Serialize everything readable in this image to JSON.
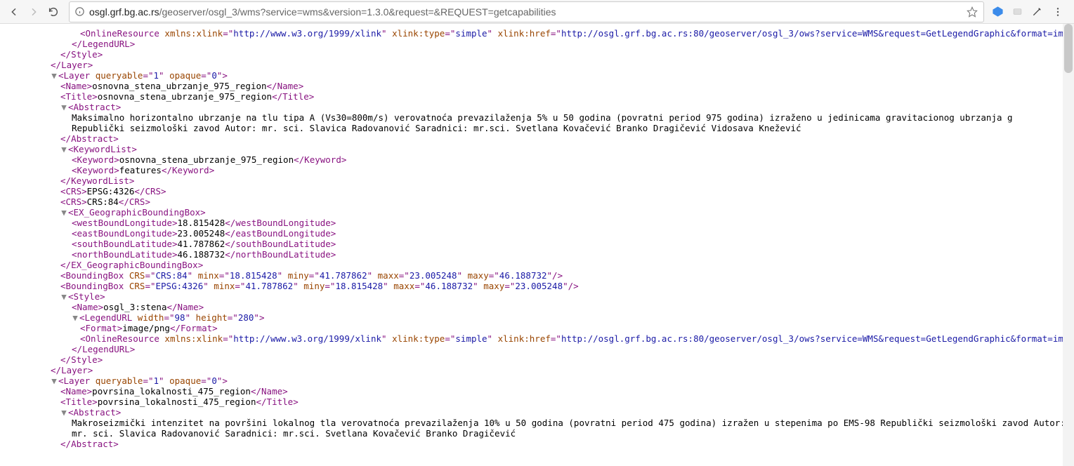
{
  "toolbar": {
    "urlHost": "osgl.grf.bg.ac.rs",
    "urlPath": "/geoserver/osgl_3/wms?service=wms&version=1.3.0&request=&REQUEST=getcapabilities"
  },
  "t": {
    "OnlineResource": "OnlineResource",
    "LegendURL_close": "LegendURL",
    "Style_close": "Style",
    "Layer_close": "Layer",
    "Layer": "Layer",
    "Name": "Name",
    "Title": "Title",
    "Abstract": "Abstract",
    "KeywordList": "KeywordList",
    "Keyword": "Keyword",
    "CRS": "CRS",
    "EX": "EX_GeographicBoundingBox",
    "wbl": "westBoundLongitude",
    "ebl": "eastBoundLongitude",
    "sbl": "southBoundLatitude",
    "nbl": "northBoundLatitude",
    "BoundingBox": "BoundingBox",
    "Style": "Style",
    "LegendURL": "LegendURL",
    "Format": "Format"
  },
  "a": {
    "xmlnsxlink": "xmlns:xlink",
    "xlinktype": "xlink:type",
    "xlinkhref": "xlink:href",
    "queryable": "queryable",
    "opaque": "opaque",
    "CRS": "CRS",
    "minx": "minx",
    "miny": "miny",
    "maxx": "maxx",
    "maxy": "maxy",
    "width": "width",
    "height": "height"
  },
  "c": {
    "xlinkNs": "http://www.w3.org/1999/xlink",
    "simple": "simple",
    "href95": "http://osgl.grf.bg.ac.rs:80/geoserver/osgl_3/ows?service=WMS&request=GetLegendGraphic&format=image%2Fpng&width=20&height=20&layer=osnovna_stena_ubrzanje_95_region",
    "href975": "http://osgl.grf.bg.ac.rs:80/geoserver/osgl_3/ows?service=WMS&request=GetLegendGraphic&format=image%2Fpng&width=20&height=20&layer=osnovna_stena_ubrzanje_975_region",
    "q1": "1",
    "o0": "0",
    "name975": "osnovna_stena_ubrzanje_975_region",
    "title975": "osnovna_stena_ubrzanje_975_region",
    "abstract975": "Maksimalno horizontalno ubrzanje na tlu tipa A (Vs30=800m/s) verovatnoća prevazilaženja 5% u 50 godina (povratni period 975 godina) izraženo u jedinicama gravitacionog ubrzanja g Republički seizmološki zavod Autor: mr. sci. Slavica Radovanović Saradnici: mr.sci. Svetlana Kovačević Branko Dragičević Vidosava Knežević",
    "kw_features": "features",
    "epsg4326": "EPSG:4326",
    "crs84": "CRS:84",
    "wbl": "18.815428",
    "ebl": "23.005248",
    "sbl": "41.787862",
    "nbl": "46.188732",
    "styleName": "osgl_3:stena",
    "lw": "98",
    "lh": "280",
    "fmt": "image/png",
    "name475": "povrsina_lokalnosti_475_region",
    "title475": "povrsina_lokalnosti_475_region",
    "abstract475": "Makroseizmički intenzitet na površini lokalnog tla verovatnoća prevazilaženja 10% u 50 godina (povratni period 475 godina) izražen u stepenima po EMS-98 Republički seizmološki zavod Autor: mr. sci. Slavica Radovanović Saradnici: mr.sci. Svetlana Kovačević Branko Dragičević"
  }
}
